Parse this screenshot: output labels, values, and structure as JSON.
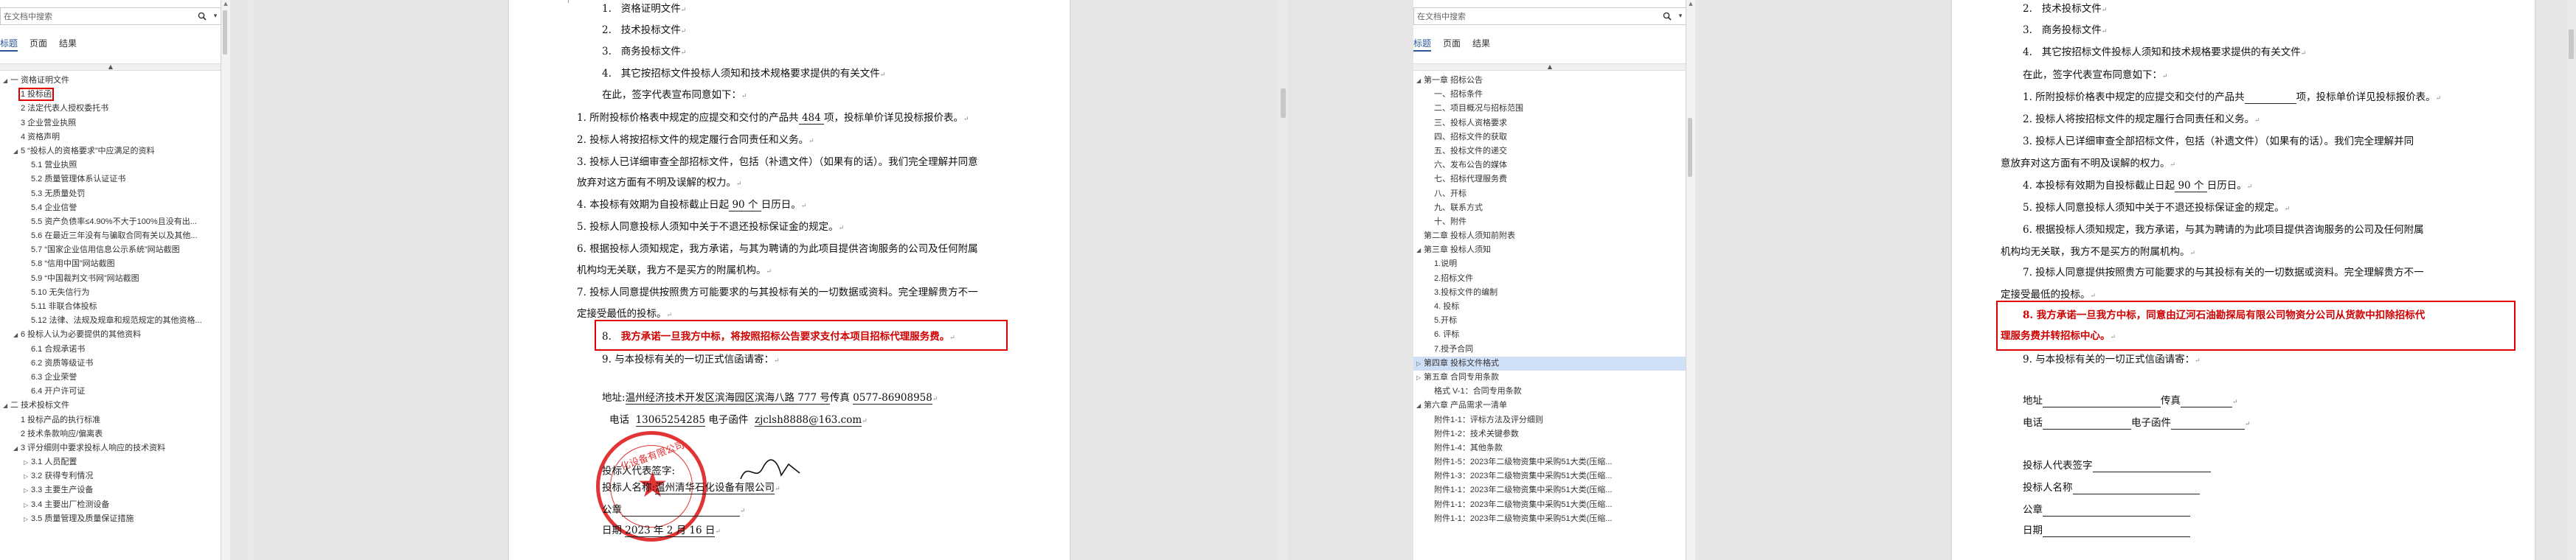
{
  "left": {
    "search_placeholder": "在文档中搜索",
    "tabs": [
      "标题",
      "页面",
      "结果"
    ],
    "nav_items": [
      {
        "label": "一 资格证明文件",
        "indent": 0,
        "tri": "◢"
      },
      {
        "label": "1 投标函",
        "indent": 1,
        "tri": "",
        "boxed": true
      },
      {
        "label": "2 法定代表人授权委托书",
        "indent": 1,
        "tri": ""
      },
      {
        "label": "3 企业营业执照",
        "indent": 1,
        "tri": ""
      },
      {
        "label": "4 资格声明",
        "indent": 1,
        "tri": ""
      },
      {
        "label": "5 “投标人的资格要求”中应满足的资料",
        "indent": 1,
        "tri": "◢"
      },
      {
        "label": "5.1 营业执照",
        "indent": 2,
        "tri": ""
      },
      {
        "label": "5.2 质量管理体系认证证书",
        "indent": 2,
        "tri": ""
      },
      {
        "label": "5.3 无质量处罚",
        "indent": 2,
        "tri": ""
      },
      {
        "label": "5.4 企业信誉",
        "indent": 2,
        "tri": ""
      },
      {
        "label": "5.5 资产负债率≤4.90%不大于100%且没有出...",
        "indent": 2,
        "tri": ""
      },
      {
        "label": "5.6 在最近三年没有与骗取合同有关以及其他...",
        "indent": 2,
        "tri": ""
      },
      {
        "label": "5.7 “国家企业信用信息公示系统”网站截图",
        "indent": 2,
        "tri": ""
      },
      {
        "label": "5.8 “信用中国”网站截图",
        "indent": 2,
        "tri": ""
      },
      {
        "label": "5.9 “中国裁判文书网”网站截图",
        "indent": 2,
        "tri": ""
      },
      {
        "label": "5.10 无失信行为",
        "indent": 2,
        "tri": ""
      },
      {
        "label": "5.11 非联合体投标",
        "indent": 2,
        "tri": ""
      },
      {
        "label": "5.12 法律、法规及规章和规范规定的其他资格...",
        "indent": 2,
        "tri": ""
      },
      {
        "label": "6 投标人认为必要提供的其他资料",
        "indent": 1,
        "tri": "◢"
      },
      {
        "label": "6.1 合规承诺书",
        "indent": 2,
        "tri": ""
      },
      {
        "label": "6.2 资质等级证书",
        "indent": 2,
        "tri": ""
      },
      {
        "label": "6.3 企业荣誉",
        "indent": 2,
        "tri": ""
      },
      {
        "label": "6.4 开户许可证",
        "indent": 2,
        "tri": ""
      },
      {
        "label": "二 技术投标文件",
        "indent": 0,
        "tri": "◢"
      },
      {
        "label": "1 投标产品的执行标准",
        "indent": 1,
        "tri": ""
      },
      {
        "label": "2 技术条款响应/偏离表",
        "indent": 1,
        "tri": ""
      },
      {
        "label": "3 评分细则中要求投标人响应的技术资料",
        "indent": 1,
        "tri": "◢"
      },
      {
        "label": "3.1 人员配置",
        "indent": 2,
        "tri": "▷"
      },
      {
        "label": "3.2 获得专利情况",
        "indent": 2,
        "tri": "▷"
      },
      {
        "label": "3.3 主要生产设备",
        "indent": 2,
        "tri": "▷"
      },
      {
        "label": "3.4 主要出厂检测设备",
        "indent": 2,
        "tri": "▷"
      },
      {
        "label": "3.5 质量管理及质量保证措施",
        "indent": 2,
        "tri": "▷"
      }
    ],
    "doc": {
      "items_top": [
        "1.",
        "2.",
        "3.",
        "4."
      ],
      "items_top_text": [
        "资格证明文件",
        "技术投标文件",
        "商务投标文件",
        "其它按招标文件投标人须知和技术规格要求提供的有关文件"
      ],
      "undersigned": "在此，签字代表宣布同意如下：",
      "p1a": "1. 所附投标价格表中规定的应提交和交付的产品共",
      "p1_num": "484",
      "p1b": "项，投标单价详见投标报价表。",
      "p2": "2. 投标人将按招标文件的规定履行合同责任和义务。",
      "p3a": "3. 投标人已详细审查全部招标文件，包括（补遗文件）（如果有的话）。我们完全理解并同意",
      "p3b": "放弃对这方面有不明及误解的权力。",
      "p4a": "4. 本投标有效期为自投标截止日起",
      "p4_num": "90",
      "p4_unit": "个",
      "p4b": "日历日。",
      "p5": "5. 投标人同意投标人须知中关于不退还投标保证金的规定。",
      "p6a": "6. 根据投标人须知规定，我方承诺，与其为聘请的为此项目提供咨询服务的公司及任何附属",
      "p6b": "机构均无关联，我方不是买方的附属机构。",
      "p7a": "7. 投标人同意提供按照贵方可能要求的与其投标有关的一切数据或资料。完全理解贵方不一",
      "p7b": "定接受最低的投标。",
      "p8_num": "8.",
      "p8": "我方承诺一旦我方中标，将按照招标公告要求支付本项目招标代理服务费。",
      "p9": "9. 与本投标有关的一切正式信函请寄：",
      "addr_label": "地址:",
      "addr": "温州经济技术开发区滨海园区滨海八路 777 号",
      "fax_label": "传真",
      "fax": "0577-86908958",
      "tel_label": "电话",
      "tel": "13065254285",
      "email_label": "电子函件",
      "email": "zjclsh8888@163.com",
      "rep_label": "投标人代表签字:",
      "name_label": "投标人名称:",
      "name": "温州清华石化设备有限公司",
      "seal_label": "公章",
      "date_label": "日期",
      "date": "2023 年 2 月 16 日",
      "stamp_text": "化设备有限公司"
    }
  },
  "right": {
    "search_placeholder": "在文档中搜索",
    "tabs": [
      "标题",
      "页面",
      "结果"
    ],
    "nav_items": [
      {
        "label": "第一章 招标公告",
        "indent": 0,
        "tri": "◢"
      },
      {
        "label": "一、招标条件",
        "indent": 1,
        "tri": ""
      },
      {
        "label": "二、项目概况与招标范围",
        "indent": 1,
        "tri": ""
      },
      {
        "label": "三、投标人资格要求",
        "indent": 1,
        "tri": ""
      },
      {
        "label": "四、招标文件的获取",
        "indent": 1,
        "tri": ""
      },
      {
        "label": "五、投标文件的递交",
        "indent": 1,
        "tri": ""
      },
      {
        "label": "六、发布公告的媒体",
        "indent": 1,
        "tri": ""
      },
      {
        "label": "七、招标代理服务费",
        "indent": 1,
        "tri": ""
      },
      {
        "label": "八、开标",
        "indent": 1,
        "tri": ""
      },
      {
        "label": "九、联系方式",
        "indent": 1,
        "tri": ""
      },
      {
        "label": "十、附件",
        "indent": 1,
        "tri": ""
      },
      {
        "label": "第二章 投标人须知前附表",
        "indent": 0,
        "tri": ""
      },
      {
        "label": "第三章 投标人须知",
        "indent": 0,
        "tri": "◢"
      },
      {
        "label": "1.说明",
        "indent": 1,
        "tri": ""
      },
      {
        "label": "2.招标文件",
        "indent": 1,
        "tri": ""
      },
      {
        "label": "3.投标文件的编制",
        "indent": 1,
        "tri": ""
      },
      {
        "label": "4. 投标",
        "indent": 1,
        "tri": ""
      },
      {
        "label": "5.开标",
        "indent": 1,
        "tri": ""
      },
      {
        "label": "6. 评标",
        "indent": 1,
        "tri": ""
      },
      {
        "label": "7.授予合同",
        "indent": 1,
        "tri": ""
      },
      {
        "label": "第四章 投标文件格式",
        "indent": 0,
        "tri": "▷",
        "selected": true
      },
      {
        "label": "第五章 合同专用条款",
        "indent": 0,
        "tri": "▷"
      },
      {
        "label": "格式 V-1：合同专用条款",
        "indent": 1,
        "tri": ""
      },
      {
        "label": "第六章 产品需求一清单",
        "indent": 0,
        "tri": "◢"
      },
      {
        "label": "附件1-1：评标方法及评分细则",
        "indent": 1,
        "tri": ""
      },
      {
        "label": "附件1-2：技术关键参数",
        "indent": 1,
        "tri": ""
      },
      {
        "label": "附件1-4：其他条款",
        "indent": 1,
        "tri": ""
      },
      {
        "label": "附件1-5：2023年二级物资集中采购51大类(压缩...",
        "indent": 1,
        "tri": ""
      },
      {
        "label": "附件1-3：2023年二级物资集中采购51大类(压缩...",
        "indent": 1,
        "tri": ""
      },
      {
        "label": "附件1-1：2023年二级物资集中采购51大类(压缩...",
        "indent": 1,
        "tri": ""
      },
      {
        "label": "附件1-1：2023年二级物资集中采购51大类(压缩...",
        "indent": 1,
        "tri": ""
      },
      {
        "label": "附件1-1：2023年二级物资集中采购51大类(压缩...",
        "indent": 1,
        "tri": ""
      }
    ],
    "doc": {
      "items_top_text": [
        "技术投标文件",
        "商务投标文件",
        "其它按招标文件投标人须知和技术规格要求提供的有关文件"
      ],
      "items_top_num": [
        "2.",
        "3.",
        "4."
      ],
      "undersigned": "在此，签字代表宣布同意如下：",
      "p1a": "1. 所附投标价格表中规定的应提交和交付的产品共",
      "p1b": "项，投标单价详见投标报价表。",
      "p2": "2. 投标人将按招标文件的规定履行合同责任和义务。",
      "p3a": "3. 投标人已详细审查全部招标文件，包括（补遗文件）（如果有的话）。我们完全理解并同",
      "p3b": "意放弃对这方面有不明及误解的权力。",
      "p4a": "4. 本投标有效期为自投标截止日起",
      "p4_num": "90",
      "p4_unit": "个",
      "p4b": "日历日。",
      "p5": "5. 投标人同意投标人须知中关于不退还投标保证金的规定。",
      "p6a": "6. 根据投标人须知规定，我方承诺，与其为聘请的为此项目提供咨询服务的公司及任何附属",
      "p6b": "机构均无关联，我方不是买方的附属机构。",
      "p7a": "7. 投标人同意提供按照贵方可能要求的与其投标有关的一切数据或资料。完全理解贵方不一",
      "p7b": "定接受最低的投标。",
      "p8a": "8. 我方承诺一旦我方中标，同意由辽河石油勘探局有限公司物资分公司从货款中扣除招标代",
      "p8b": "理服务费并转招标中心。",
      "p9": "9. 与本投标有关的一切正式信函请寄：",
      "addr_label": "地址",
      "fax_label": "传真",
      "tel_label": "电话",
      "email_label": "电子函件",
      "rep_label": "投标人代表签字",
      "name_label": "投标人名称",
      "seal_label": "公章",
      "date_label": "日期"
    }
  },
  "colors": {
    "accent": "#2b579a",
    "highlight": "#e00000",
    "selected_row": "#cfe0f6"
  }
}
